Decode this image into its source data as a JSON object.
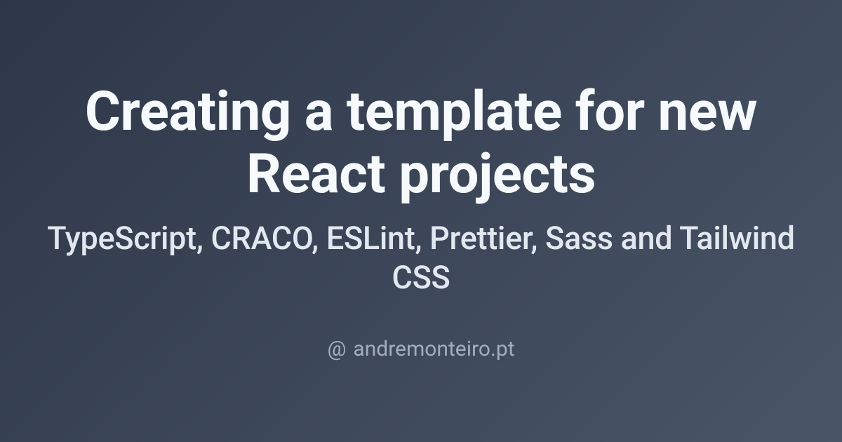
{
  "title": "Creating a template for new React projects",
  "subtitle": "TypeScript, CRACO, ESLint, Prettier, Sass and Tailwind CSS",
  "attribution": {
    "prefix": "@",
    "domain": "andremonteiro.pt"
  }
}
